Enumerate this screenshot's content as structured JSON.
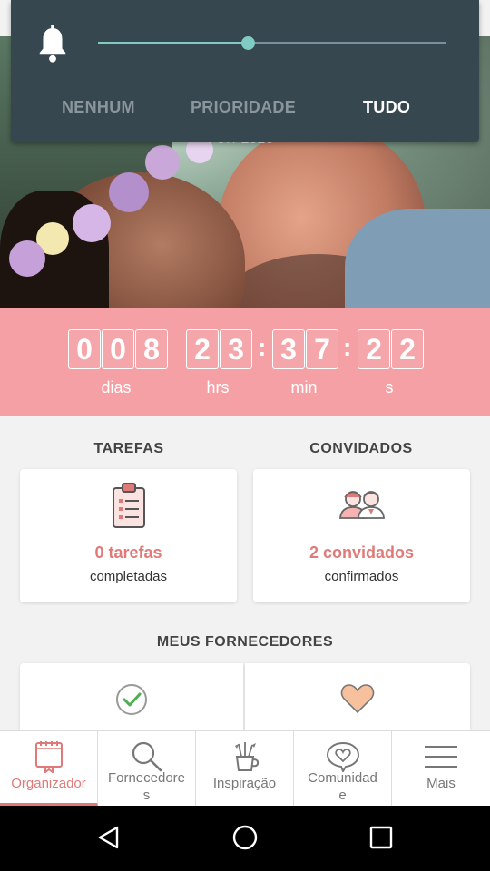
{
  "notification": {
    "icon": "bell-icon",
    "slider_level_percent": 43,
    "options": [
      "NENHUM",
      "PRIORIDADE",
      "TUDO"
    ],
    "selected": "TUDO"
  },
  "hero": {
    "date_partial": "/ 07/ 2016"
  },
  "countdown": {
    "days": [
      "0",
      "0",
      "8"
    ],
    "hours": [
      "2",
      "3"
    ],
    "minutes": [
      "3",
      "7"
    ],
    "seconds": [
      "2",
      "2"
    ],
    "labels": {
      "days": "dias",
      "hours": "hrs",
      "minutes": "min",
      "seconds": "s"
    }
  },
  "tasks": {
    "title": "TAREFAS",
    "count": "0 tarefas",
    "subtitle": "completadas",
    "icon": "clipboard-icon"
  },
  "guests": {
    "title": "CONVIDADOS",
    "count": "2 convidados",
    "subtitle": "confirmados",
    "icon": "couple-icon"
  },
  "vendors": {
    "title": "MEUS FORNECEDORES",
    "icons": [
      "check-icon",
      "heart-icon"
    ]
  },
  "bottom_nav": [
    {
      "label": "Organizador",
      "icon": "notebook-icon",
      "active": true
    },
    {
      "label": "Fornecedore\ns",
      "icon": "search-icon",
      "active": false
    },
    {
      "label": "Inspiração",
      "icon": "vase-icon",
      "active": false
    },
    {
      "label": "Comunidad\ne",
      "icon": "heart-bubble-icon",
      "active": false
    },
    {
      "label": "Mais",
      "icon": "menu-icon",
      "active": false
    }
  ],
  "colors": {
    "accent": "#e07a78",
    "countdown_bg": "#f5a0a4",
    "panel_bg": "#37474f",
    "slider": "#80cbc4"
  }
}
